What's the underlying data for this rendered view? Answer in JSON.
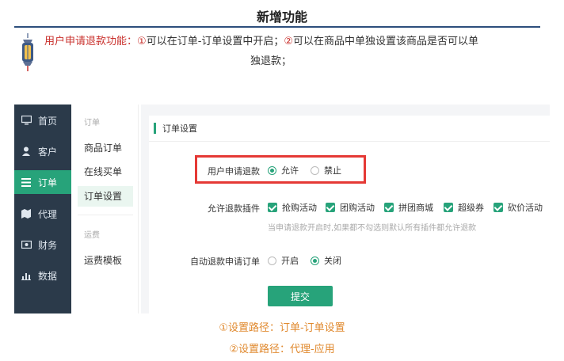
{
  "title": "新增功能",
  "intro": {
    "feature_name": "用户申请退款功能",
    "colon": "：",
    "marker1": "①",
    "text1": "可以在订单-订单设置中开启；",
    "marker2": "②",
    "text2": "可以在商品中单独设置该商品是否可以单",
    "text3": "独退款；"
  },
  "nav": {
    "items": [
      {
        "label": "首页",
        "icon": "monitor-icon"
      },
      {
        "label": "客户",
        "icon": "user-icon"
      },
      {
        "label": "订单",
        "icon": "list-icon",
        "active": true
      },
      {
        "label": "代理",
        "icon": "map-icon"
      },
      {
        "label": "财务",
        "icon": "money-icon"
      },
      {
        "label": "数据",
        "icon": "chart-icon"
      }
    ]
  },
  "subnav": {
    "group1": "订单",
    "items1": [
      "商品订单",
      "在线买单",
      "订单设置"
    ],
    "group2": "运费",
    "items2": [
      "运费模板"
    ]
  },
  "panel": {
    "header": "订单设置",
    "refund": {
      "label": "用户申请退款",
      "opt_on": "允许",
      "opt_off": "禁止"
    },
    "plugins": {
      "label": "允许退款插件",
      "items": [
        "抢购活动",
        "团购活动",
        "拼团商城",
        "超级券",
        "砍价活动"
      ],
      "hint": "当申请退款开启时,如果都不勾选则默认所有插件都允许退款"
    },
    "auto": {
      "label": "自动退款申请订单",
      "opt_on": "开启",
      "opt_off": "关闭"
    },
    "submit": "提交"
  },
  "paths": {
    "line1": "①设置路径：订单-订单设置",
    "line2": "②设置路径：代理-应用"
  },
  "colors": {
    "accent": "#27a37a",
    "nav_bg": "#2b3a4a",
    "highlight": "#e53935",
    "path_text": "#e0892e"
  }
}
